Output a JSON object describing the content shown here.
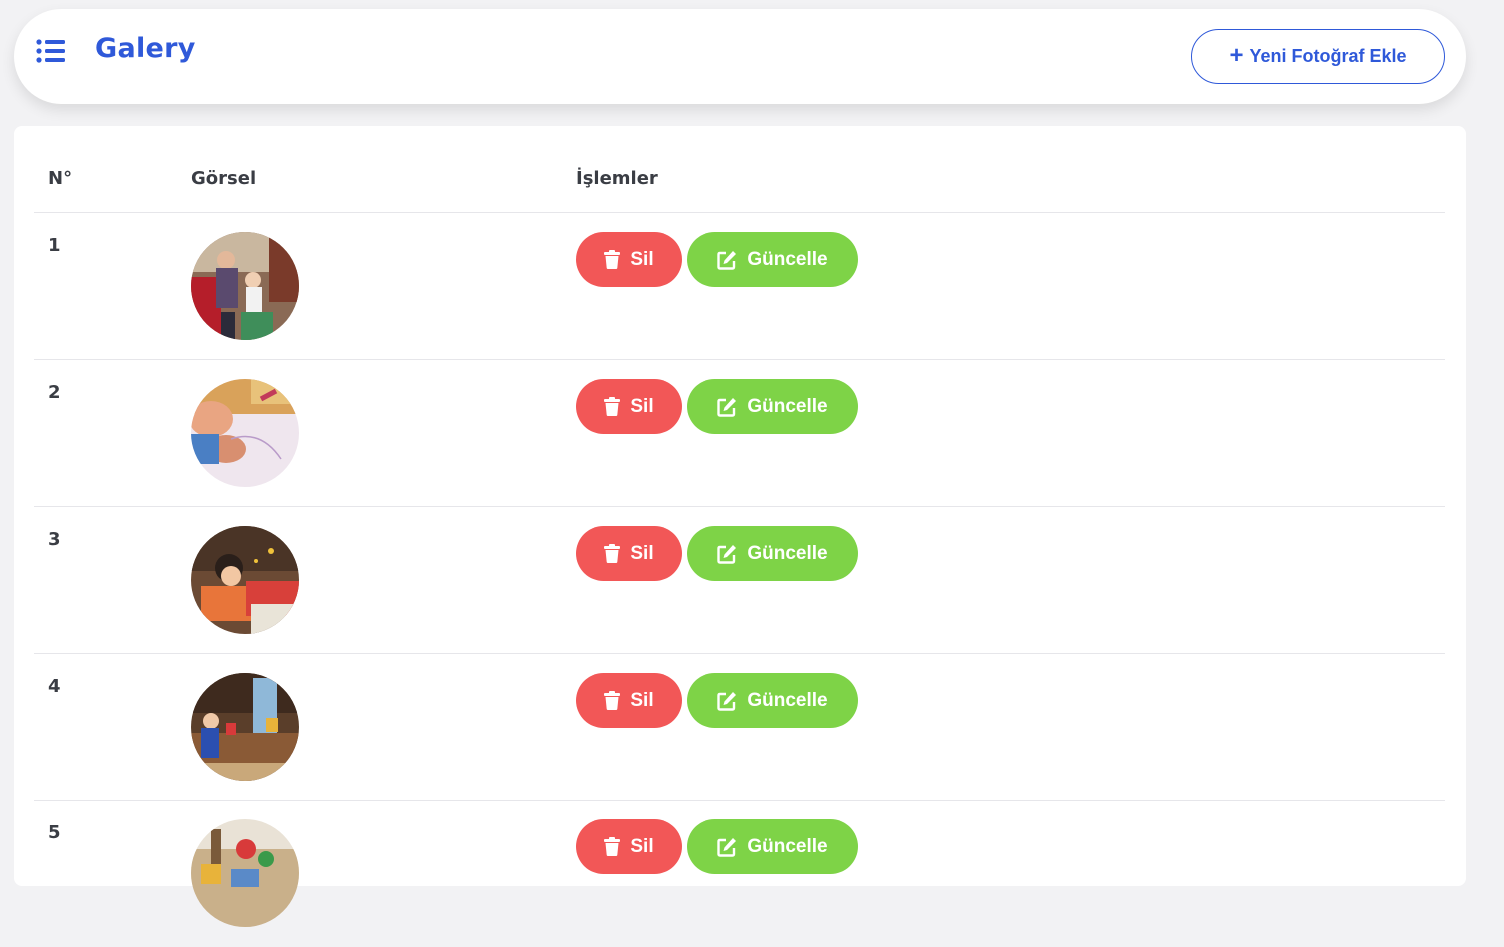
{
  "header": {
    "title": "Galery",
    "add_button_label": "Yeni Fotoğraf Ekle",
    "menu_icon": "list-icon"
  },
  "table": {
    "columns": {
      "number": "N°",
      "image": "Görsel",
      "actions": "İşlemler"
    },
    "rows": [
      {
        "number": "1",
        "delete_label": "Sil",
        "update_label": "Güncelle"
      },
      {
        "number": "2",
        "delete_label": "Sil",
        "update_label": "Güncelle"
      },
      {
        "number": "3",
        "delete_label": "Sil",
        "update_label": "Güncelle"
      },
      {
        "number": "4",
        "delete_label": "Sil",
        "update_label": "Güncelle"
      },
      {
        "number": "5",
        "delete_label": "Sil",
        "update_label": "Güncelle"
      }
    ]
  },
  "colors": {
    "accent": "#2f59d9",
    "delete": "#f25757",
    "update": "#7ed347",
    "text": "#3a3d44"
  }
}
